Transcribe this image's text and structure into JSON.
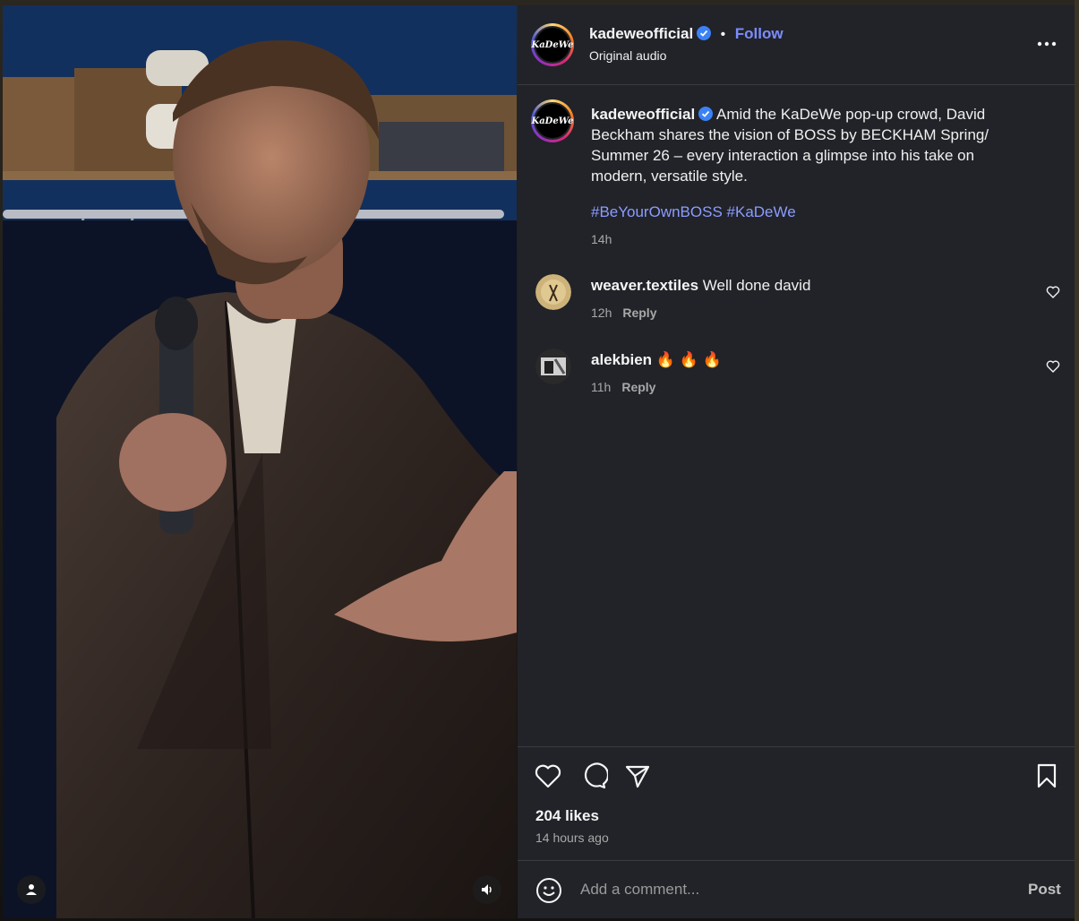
{
  "post": {
    "username": "kadeweofficial",
    "avatar_text": "KaDeWe",
    "follow_label": "Follow",
    "separator": "•",
    "audio": "Original audio",
    "caption": "Amid the KaDeWe pop-up crowd, David Beckham shares the vision of BOSS by BECKHAM Spring/ Summer 26 – every interaction a glimpse into his take on modern, versatile style.",
    "hashtags": [
      "#BeYourOwnBOSS",
      "#KaDeWe"
    ],
    "time": "14h"
  },
  "comments": [
    {
      "username": "weaver.textiles",
      "text": "Well done david",
      "time": "12h",
      "reply": "Reply",
      "avatar_icon": "weaver-avatar"
    },
    {
      "username": "alekbien",
      "text": "🔥 🔥 🔥",
      "time": "11h",
      "reply": "Reply",
      "avatar_icon": "alekbien-avatar"
    }
  ],
  "footer": {
    "likes": "204 likes",
    "time_ago": "14 hours ago",
    "composer_placeholder": "Add a comment...",
    "post_label": "Post"
  },
  "icons": {
    "like": "heart-icon",
    "comment": "comment-icon",
    "share": "share-icon",
    "save": "bookmark-icon",
    "more": "more-options-icon",
    "emoji": "emoji-icon",
    "profile": "user-icon",
    "audio": "speaker-icon"
  },
  "colors": {
    "panel_bg": "#212328",
    "link": "#7c8cff",
    "hashtag": "#8c9cff",
    "verified": "#3b82f6"
  }
}
